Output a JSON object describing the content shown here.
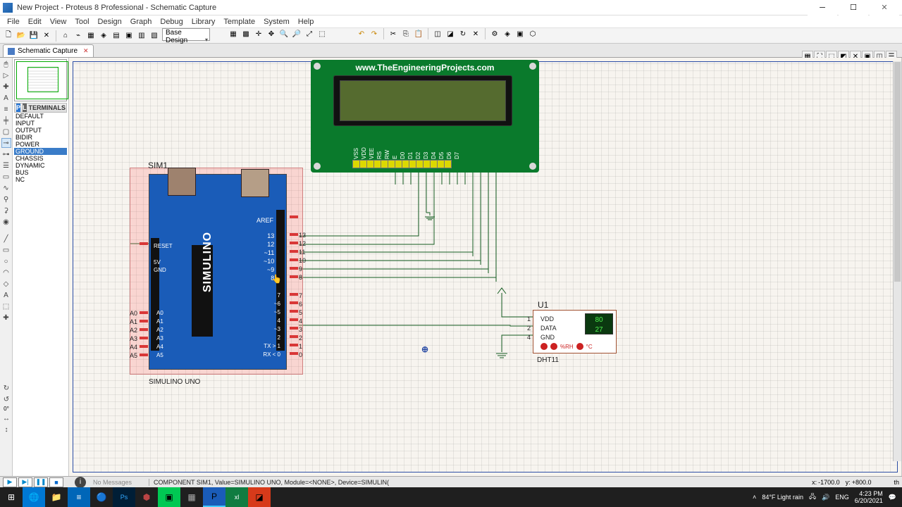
{
  "window": {
    "title": "New Project - Proteus 8 Professional - Schematic Capture"
  },
  "menu": [
    "File",
    "Edit",
    "View",
    "Tool",
    "Design",
    "Graph",
    "Debug",
    "Library",
    "Template",
    "System",
    "Help"
  ],
  "toolbar_dropdown": "Base Design",
  "tab": {
    "label": "Schematic Capture"
  },
  "terminals_header": "TERMINALS",
  "terminals": [
    "DEFAULT",
    "INPUT",
    "OUTPUT",
    "BIDIR",
    "POWER",
    "GROUND",
    "CHASSIS",
    "DYNAMIC",
    "BUS",
    "NC"
  ],
  "terminals_selected_index": 5,
  "lcd": {
    "url": "www.TheEngineeringProjects.com",
    "pins": [
      "VSS",
      "VDD",
      "VEE",
      "RS",
      "RW",
      "E",
      "D0",
      "D1",
      "D2",
      "D3",
      "D4",
      "D5",
      "D6",
      "D7"
    ]
  },
  "sim": {
    "ref": "SIM1",
    "footer": "SIMULINO UNO",
    "aref": "AREF",
    "brand": "SIMULINO",
    "reset": "RESET",
    "fivev": "5V",
    "gnd": "GND",
    "digital_pins": [
      "13",
      "12",
      "11",
      "10",
      "9",
      "8"
    ],
    "digital_pins_inner": [
      "13",
      "12",
      "~11",
      "~10",
      "~9",
      "8"
    ],
    "pwm7_0": [
      "7",
      "6",
      "5",
      "4",
      "3",
      "2",
      "1",
      "0"
    ],
    "pwm7_0_inner": [
      "7",
      "~6",
      "~5",
      "4",
      "~3",
      "2",
      "TX > 1",
      "RX < 0"
    ],
    "analog": [
      "A0",
      "A1",
      "A2",
      "A3",
      "A4",
      "A5"
    ],
    "analog_inner": [
      "A0",
      "A1",
      "A2",
      "A3",
      "A4",
      "A5"
    ]
  },
  "dht": {
    "ref": "U1",
    "name": "DHT11",
    "pins": [
      "VDD",
      "DATA",
      "GND"
    ],
    "pin_nums": [
      "1",
      "2",
      "4"
    ],
    "rh": "80",
    "temp": "27",
    "rhlabel": "%RH",
    "clabel": "°C"
  },
  "status": {
    "nomsg": "No Messages",
    "component": "COMPONENT SIM1, Value=SIMULINO UNO, Module=<NONE>, Device=SIMULIN(",
    "x": "-1700.0",
    "y": "+800.0",
    "xlabel": "x:",
    "ylabel": "y:"
  },
  "tray": {
    "weather": "84°F  Light rain",
    "lang": "ENG",
    "time": "4:23 PM",
    "date": "6/20/2021"
  }
}
